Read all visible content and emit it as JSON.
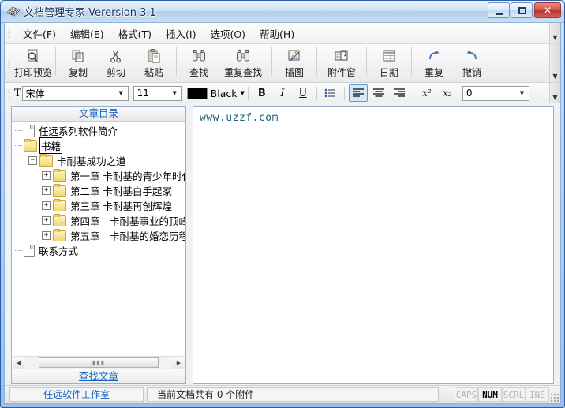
{
  "window": {
    "title": "文档管理专家 Verersion 3.1",
    "icon": "document-book-icon",
    "buttons": {
      "minimize": "minimize-button",
      "maximize": "maximize-button",
      "close": "✕"
    }
  },
  "menubar": {
    "items": [
      {
        "label": "文件(F)",
        "name": "menu-file"
      },
      {
        "label": "编辑(E)",
        "name": "menu-edit"
      },
      {
        "label": "格式(T)",
        "name": "menu-format"
      },
      {
        "label": "插入(I)",
        "name": "menu-insert"
      },
      {
        "label": "选项(O)",
        "name": "menu-options"
      },
      {
        "label": "帮助(H)",
        "name": "menu-help"
      }
    ],
    "overflow": "▼"
  },
  "toolbar": {
    "overflow": "▼",
    "buttons": [
      {
        "label": "打印预览",
        "icon": "print-preview-icon",
        "name": "toolbar-print-preview"
      },
      {
        "label": "复制",
        "icon": "copy-icon",
        "name": "toolbar-copy"
      },
      {
        "label": "剪切",
        "icon": "cut-icon",
        "name": "toolbar-cut"
      },
      {
        "label": "粘贴",
        "icon": "paste-icon",
        "name": "toolbar-paste"
      },
      {
        "label": "查找",
        "icon": "binoculars-icon",
        "name": "toolbar-find"
      },
      {
        "label": "重复查找",
        "icon": "binoculars-icon",
        "name": "toolbar-find-again"
      },
      {
        "label": "插图",
        "icon": "insert-image-icon",
        "name": "toolbar-insert-image"
      },
      {
        "label": "附件窗",
        "icon": "attachment-icon",
        "name": "toolbar-attachment-window"
      },
      {
        "label": "日期",
        "icon": "calendar-icon",
        "name": "toolbar-date"
      },
      {
        "label": "重复",
        "icon": "redo-icon",
        "name": "toolbar-redo"
      },
      {
        "label": "撤销",
        "icon": "undo-icon",
        "name": "toolbar-undo"
      }
    ]
  },
  "formatbar": {
    "overflow": "▼",
    "font_name": "宋体",
    "font_size": "11",
    "color_name": "Black",
    "color_hex": "#000000",
    "bold": "B",
    "italic": "I",
    "underline": "U",
    "bullets": "bullet-list-icon",
    "align_left": "align-left-icon",
    "align_center": "align-center-icon",
    "align_right": "align-right-icon",
    "superscript": "x²",
    "subscript": "x₂",
    "spacing_value": "0",
    "arrow": "▼"
  },
  "left_panel": {
    "header": "文章目录",
    "footer_link": "查找文章",
    "scroll": {
      "left_arrow": "◀",
      "right_arrow": "▶",
      "thumb": "▮▮▮"
    },
    "tree": [
      {
        "label": "任远系列软件简介",
        "icon": "page-icon",
        "depth": 0,
        "toggle": "",
        "focused": false,
        "name": "tree-item-intro"
      },
      {
        "label": "书籍",
        "icon": "folder-icon",
        "depth": 0,
        "toggle": "",
        "focused": true,
        "name": "tree-item-books"
      },
      {
        "label": "卡耐基成功之道",
        "icon": "folder-icon",
        "depth": 1,
        "toggle": "−",
        "focused": false,
        "name": "tree-item-carnegie"
      },
      {
        "label": "第一章  卡耐基的青少年时代",
        "icon": "folder-icon",
        "depth": 2,
        "toggle": "+",
        "focused": false,
        "name": "tree-item-chapter-1"
      },
      {
        "label": "第二章  卡耐基白手起家",
        "icon": "folder-icon",
        "depth": 2,
        "toggle": "+",
        "focused": false,
        "name": "tree-item-chapter-2"
      },
      {
        "label": "第三章  卡耐基再创辉煌",
        "icon": "folder-icon",
        "depth": 2,
        "toggle": "+",
        "focused": false,
        "name": "tree-item-chapter-3"
      },
      {
        "label": "第四章　卡耐基事业的顶峰",
        "icon": "folder-icon",
        "depth": 2,
        "toggle": "+",
        "focused": false,
        "name": "tree-item-chapter-4"
      },
      {
        "label": "第五章　卡耐基的婚恋历程",
        "icon": "folder-icon",
        "depth": 2,
        "toggle": "+",
        "focused": false,
        "name": "tree-item-chapter-5"
      },
      {
        "label": "联系方式",
        "icon": "page-icon",
        "depth": 0,
        "toggle": "",
        "focused": false,
        "name": "tree-item-contact"
      }
    ]
  },
  "editor": {
    "content_link": "www.uzzf.com"
  },
  "statusbar": {
    "brand": "任远软件工作室",
    "document_info": "当前文档共有  0  个附件",
    "indicators": [
      {
        "label": "CAPS",
        "active": false
      },
      {
        "label": "NUM",
        "active": true
      },
      {
        "label": "SCRL",
        "active": false
      },
      {
        "label": "INS",
        "active": false
      }
    ]
  }
}
